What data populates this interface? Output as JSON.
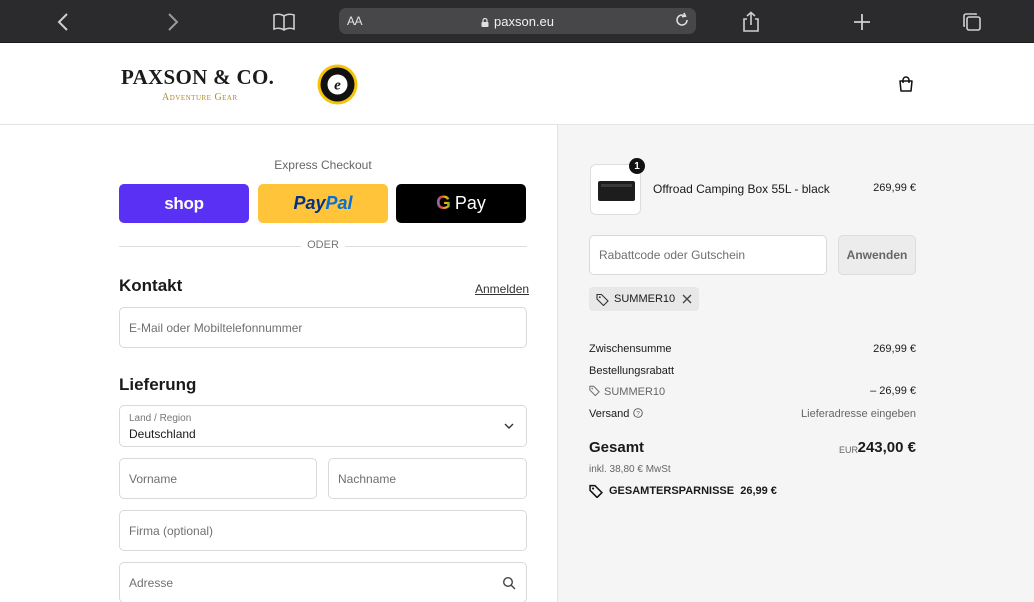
{
  "browser": {
    "text_size_label": "AA",
    "url": "paxson.eu"
  },
  "header": {
    "logo_main": "PAXSON & CO.",
    "logo_sub": "Adventure Gear"
  },
  "express": {
    "title": "Express Checkout",
    "shop_label": "shop",
    "paypal_label_a": "Pay",
    "paypal_label_b": "Pal",
    "gpay_g": "G",
    "gpay_label": "Pay",
    "divider": "ODER"
  },
  "contact": {
    "title": "Kontakt",
    "login_link": "Anmelden",
    "email_placeholder": "E-Mail oder Mobiltelefonnummer"
  },
  "delivery": {
    "title": "Lieferung",
    "country_label": "Land / Region",
    "country_value": "Deutschland",
    "first_name_placeholder": "Vorname",
    "last_name_placeholder": "Nachname",
    "company_placeholder": "Firma (optional)",
    "address_placeholder": "Adresse"
  },
  "cart": {
    "item": {
      "quantity": "1",
      "name": "Offroad Camping Box 55L - black",
      "price": "269,99 €"
    },
    "coupon_placeholder": "Rabattcode oder Gutschein",
    "apply_label": "Anwenden",
    "applied_code": "SUMMER10"
  },
  "summary": {
    "subtotal_label": "Zwischensumme",
    "subtotal_value": "269,99 €",
    "discount_label": "Bestellungsrabatt",
    "discount_code": "SUMMER10",
    "discount_value": "– 26,99 €",
    "shipping_label": "Versand",
    "shipping_value": "Lieferadresse eingeben",
    "total_label": "Gesamt",
    "total_currency": "EUR",
    "total_value": "243,00 €",
    "tax_line": "inkl. 38,80 € MwSt",
    "savings_label": "GESAMTERSPARNISSE",
    "savings_value": "26,99 €"
  },
  "colors": {
    "shop_pay": "#5a31f4",
    "paypal": "#ffc439",
    "gpay": "#000000",
    "logo_gold": "#b08a2a"
  }
}
